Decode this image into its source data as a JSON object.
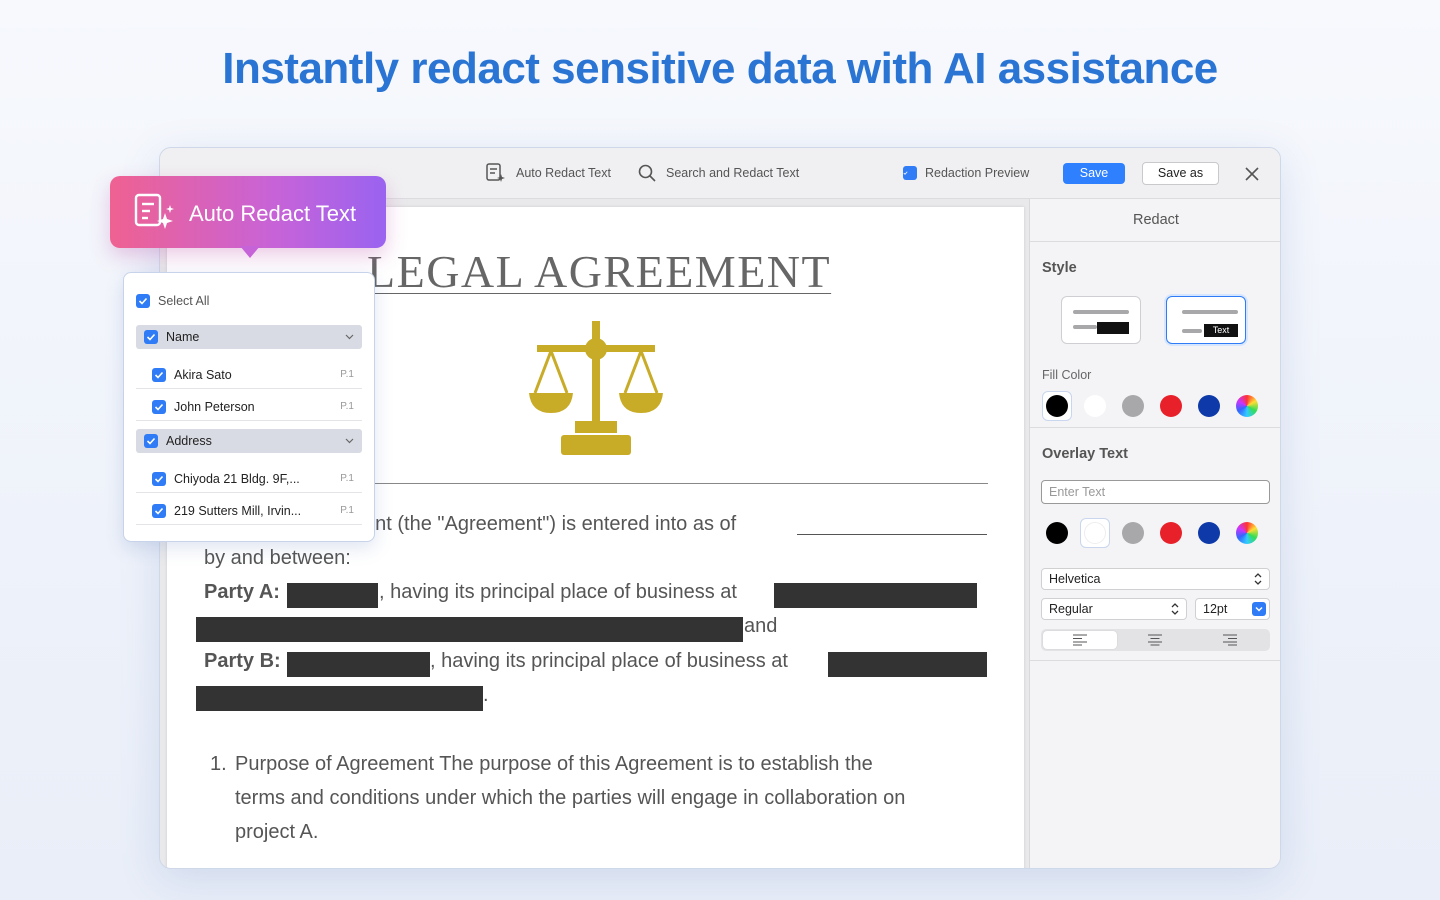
{
  "headline": "Instantly redact sensitive data with AI assistance",
  "toolbar": {
    "auto_redact": "Auto Redact Text",
    "search_redact": "Search and Redact Text",
    "redaction_preview": "Redaction Preview",
    "save": "Save",
    "save_as": "Save as"
  },
  "document": {
    "title": "LEGAL AGREEMENT",
    "intro_line": "ent (the \"Agreement\") is entered into as of",
    "by_between": "by and between:",
    "party_a_label": "Party A:",
    "party_a_text": ", having its principal place of business at",
    "and_text": "and",
    "party_b_label": "Party B:",
    "party_b_text": ", having its principal place of business at",
    "period": ".",
    "list_number": "1.",
    "list_line1": "Purpose of Agreement The purpose of this Agreement is to establish the",
    "list_line2": "terms and conditions under which the parties will engage in collaboration on",
    "list_line3": "project A."
  },
  "side": {
    "header": "Redact",
    "style_label": "Style",
    "style_card_text": "Text",
    "fill_color_label": "Fill Color",
    "overlay_label": "Overlay Text",
    "overlay_placeholder": "Enter Text",
    "font": "Helvetica",
    "weight": "Regular",
    "size": "12pt",
    "colors": [
      "#000000",
      "#ffffff",
      "#a8a8ab",
      "#e8202a",
      "#0d3aa8"
    ]
  },
  "badge": {
    "label": "Auto Redact Text"
  },
  "dropdown": {
    "select_all": "Select All",
    "group_name": "Name",
    "name_1": "Akira Sato",
    "name_1_page": "P.1",
    "name_2": "John Peterson",
    "name_2_page": "P.1",
    "group_address": "Address",
    "addr_1": "Chiyoda 21 Bldg. 9F,...",
    "addr_1_page": "P.1",
    "addr_2": "219 Sutters Mill, Irvin...",
    "addr_2_page": "P.1"
  }
}
